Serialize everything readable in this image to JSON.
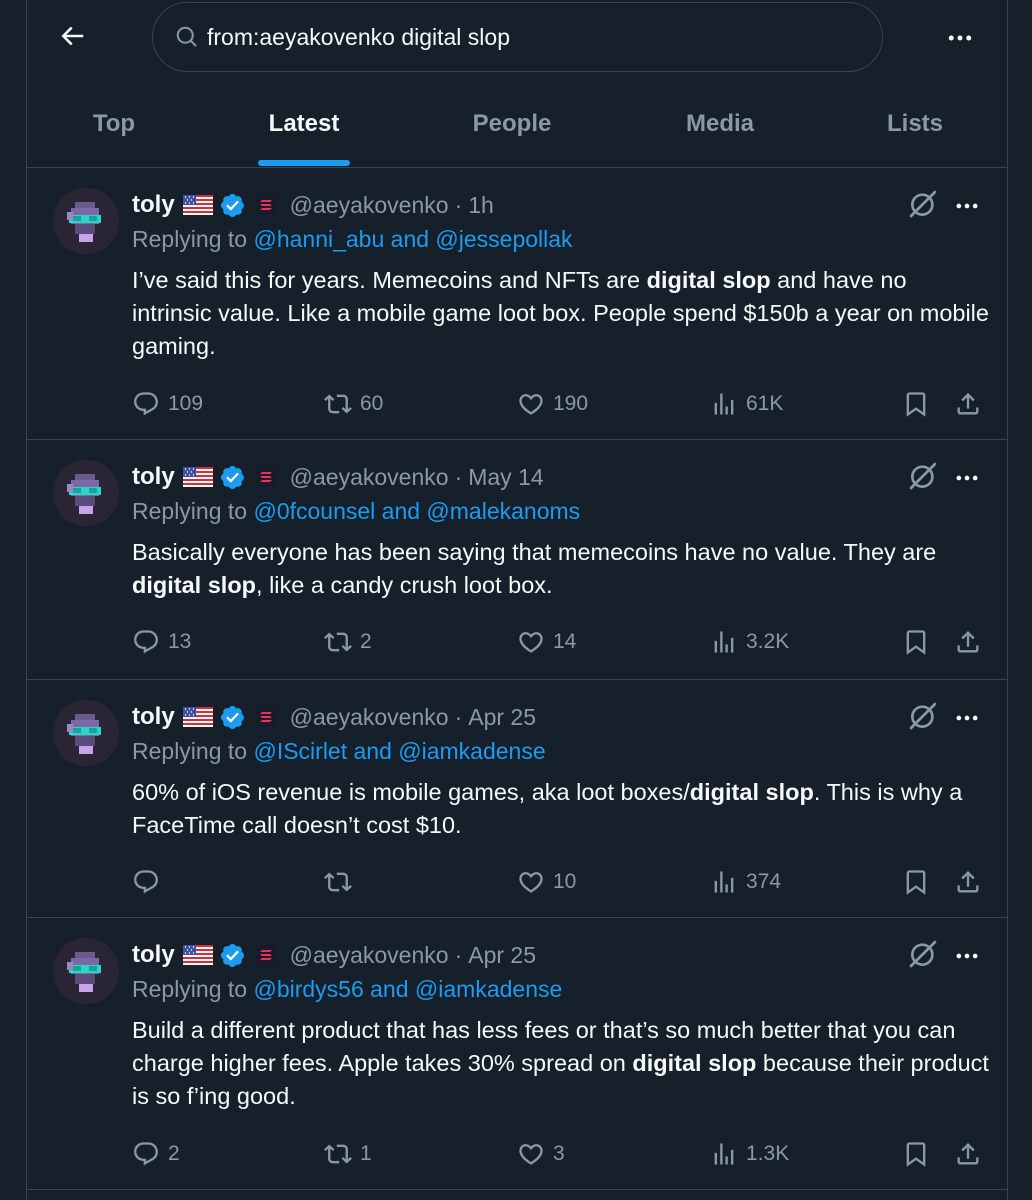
{
  "search": {
    "query": "from:aeyakovenko digital slop"
  },
  "tabs": [
    {
      "label": "Top"
    },
    {
      "label": "Latest"
    },
    {
      "label": "People"
    },
    {
      "label": "Media"
    },
    {
      "label": "Lists"
    }
  ],
  "active_tab": "Latest",
  "colors": {
    "background": "#15202b",
    "accent": "#1d9bf0",
    "muted": "#8b98a5",
    "border": "#38444d"
  },
  "tweets": [
    {
      "name": "toly",
      "handle": "@aeyakovenko",
      "dot": "·",
      "time": "1h",
      "reply_prefix": "Replying to ",
      "reply_to": "@hanni_abu and @jessepollak",
      "text_parts": [
        "I’ve said this for years.  Memecoins and NFTs are ",
        "digital slop",
        " and have no intrinsic value.  Like a mobile game loot box.  People spend $150b a year on mobile gaming."
      ],
      "replies": "109",
      "reposts": "60",
      "likes": "190",
      "views": "61K"
    },
    {
      "name": "toly",
      "handle": "@aeyakovenko",
      "dot": "·",
      "time": "May 14",
      "reply_prefix": "Replying to ",
      "reply_to": "@0fcounsel and @malekanoms",
      "text_parts": [
        "Basically everyone has been saying that memecoins have no value.  They are ",
        "digital slop",
        ", like a candy crush loot box."
      ],
      "replies": "13",
      "reposts": "2",
      "likes": "14",
      "views": "3.2K"
    },
    {
      "name": "toly",
      "handle": "@aeyakovenko",
      "dot": "·",
      "time": "Apr 25",
      "reply_prefix": "Replying to ",
      "reply_to": "@IScirlet and @iamkadense",
      "text_parts": [
        "60% of iOS revenue is mobile games, aka loot boxes/",
        "digital slop",
        ".  This is why a FaceTime call doesn’t cost $10."
      ],
      "replies": "",
      "reposts": "",
      "likes": "10",
      "views": "374"
    },
    {
      "name": "toly",
      "handle": "@aeyakovenko",
      "dot": "·",
      "time": "Apr 25",
      "reply_prefix": "Replying to ",
      "reply_to": "@birdys56 and @iamkadense",
      "text_parts": [
        "Build a different product that has less fees or that’s so much better that you can charge higher fees. Apple takes 30% spread on ",
        "digital slop",
        " because their product is so f’ing good."
      ],
      "replies": "2",
      "reposts": "1",
      "likes": "3",
      "views": "1.3K"
    }
  ]
}
